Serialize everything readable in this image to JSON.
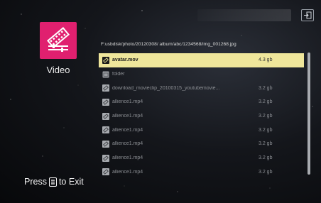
{
  "app": {
    "label": "Video",
    "icon": "video-film-icon"
  },
  "toolbar": {
    "exit_icon": "exit-icon"
  },
  "path": "F:usbdisk/photo/20120308/ album/abc/1234568/img_001268.jpg",
  "files": [
    {
      "name": "avatar.mov",
      "size": "4.3 gb",
      "type": "video",
      "selected": true
    },
    {
      "name": "folder",
      "size": "",
      "type": "folder",
      "selected": false
    },
    {
      "name": "download_movieclip_20100315_youtubemovie...",
      "size": "3.2 gb",
      "type": "video",
      "selected": false
    },
    {
      "name": "allience1.mp4",
      "size": "3.2 gb",
      "type": "video",
      "selected": false
    },
    {
      "name": "allience1.mp4",
      "size": "3.2 gb",
      "type": "video",
      "selected": false
    },
    {
      "name": "allience1.mp4",
      "size": "3.2 gb",
      "type": "video",
      "selected": false
    },
    {
      "name": "allience1.mp4",
      "size": "3.2 gb",
      "type": "video",
      "selected": false
    },
    {
      "name": "allience1.mp4",
      "size": "3.2 gb",
      "type": "video",
      "selected": false
    },
    {
      "name": "allience1.mp4",
      "size": "3.2 gb",
      "type": "video",
      "selected": false
    }
  ],
  "footer": {
    "press": "Press",
    "to_exit": "to Exit",
    "key_icon": "menu-key-icon"
  },
  "colors": {
    "tile": "#e0206f",
    "selected_row": "#efe69b",
    "background": "#0d0f13"
  }
}
